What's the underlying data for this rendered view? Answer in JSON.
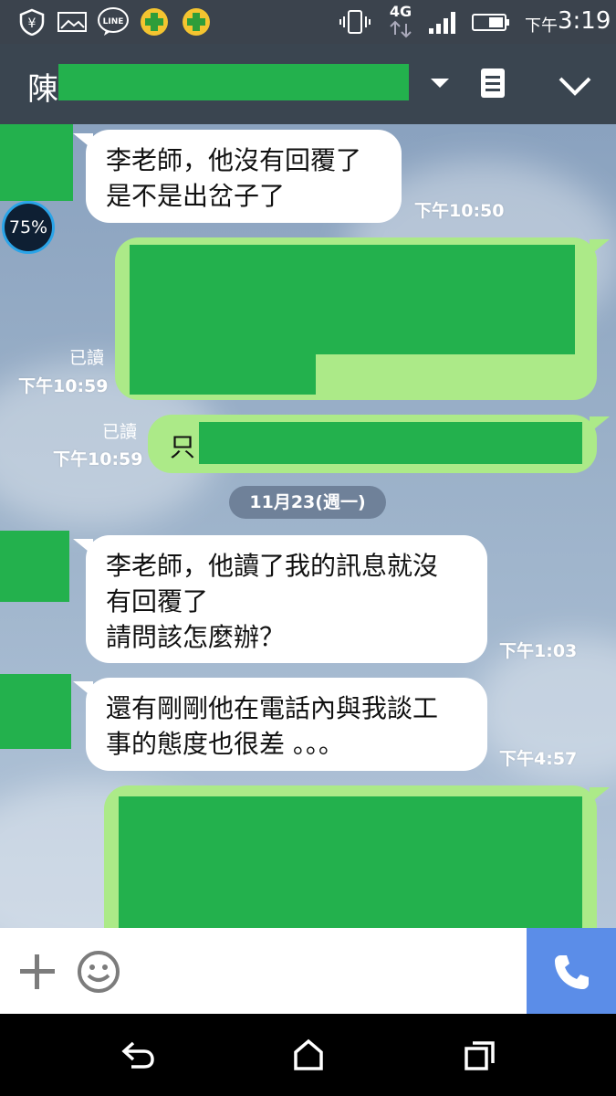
{
  "status_bar": {
    "network": "4G",
    "ampm": "下午",
    "time": "3:19",
    "notification_icons": [
      "yen-shield-icon",
      "image-icon",
      "line-icon",
      "plus-badge-icon",
      "plus-badge-icon"
    ],
    "system_icons": [
      "vibrate-icon",
      "network-4g-icon",
      "signal-icon",
      "battery-icon"
    ]
  },
  "header": {
    "contact_name_visible": "陳",
    "icons": [
      "dropdown-caret-icon",
      "notes-icon",
      "collapse-chevron-icon"
    ]
  },
  "floating_widget": {
    "label": "75%"
  },
  "messages": [
    {
      "side": "in",
      "lines": [
        "李老師，他沒有回覆了",
        "是不是出岔子了"
      ],
      "time": "下午10:50"
    },
    {
      "side": "out",
      "read": "已讀",
      "time": "下午10:59",
      "redacted": true
    },
    {
      "side": "out",
      "visible_prefix": "只",
      "read": "已讀",
      "time": "下午10:59",
      "redacted": true
    },
    {
      "side": "date",
      "label": "11月23(週一)"
    },
    {
      "side": "in",
      "lines": [
        "李老師，他讀了我的訊息就沒",
        "有回覆了",
        "請問該怎麼辦？"
      ],
      "time": "下午1:03"
    },
    {
      "side": "in",
      "lines": [
        "還有剛剛他在電話內與我談工",
        "事的態度也很差 。。。"
      ],
      "time": "下午4:57"
    },
    {
      "side": "out",
      "redacted": true
    }
  ],
  "input_bar": {
    "icons": [
      "plus-icon",
      "emoji-icon",
      "phone-call-icon"
    ]
  },
  "nav_bar": {
    "icons": [
      "back-icon",
      "home-icon",
      "recents-icon"
    ]
  },
  "colors": {
    "accent_green": "#23b14d",
    "bubble_out": "#acea88",
    "call_button": "#5b8de8",
    "header_bg": "#3a4550"
  }
}
